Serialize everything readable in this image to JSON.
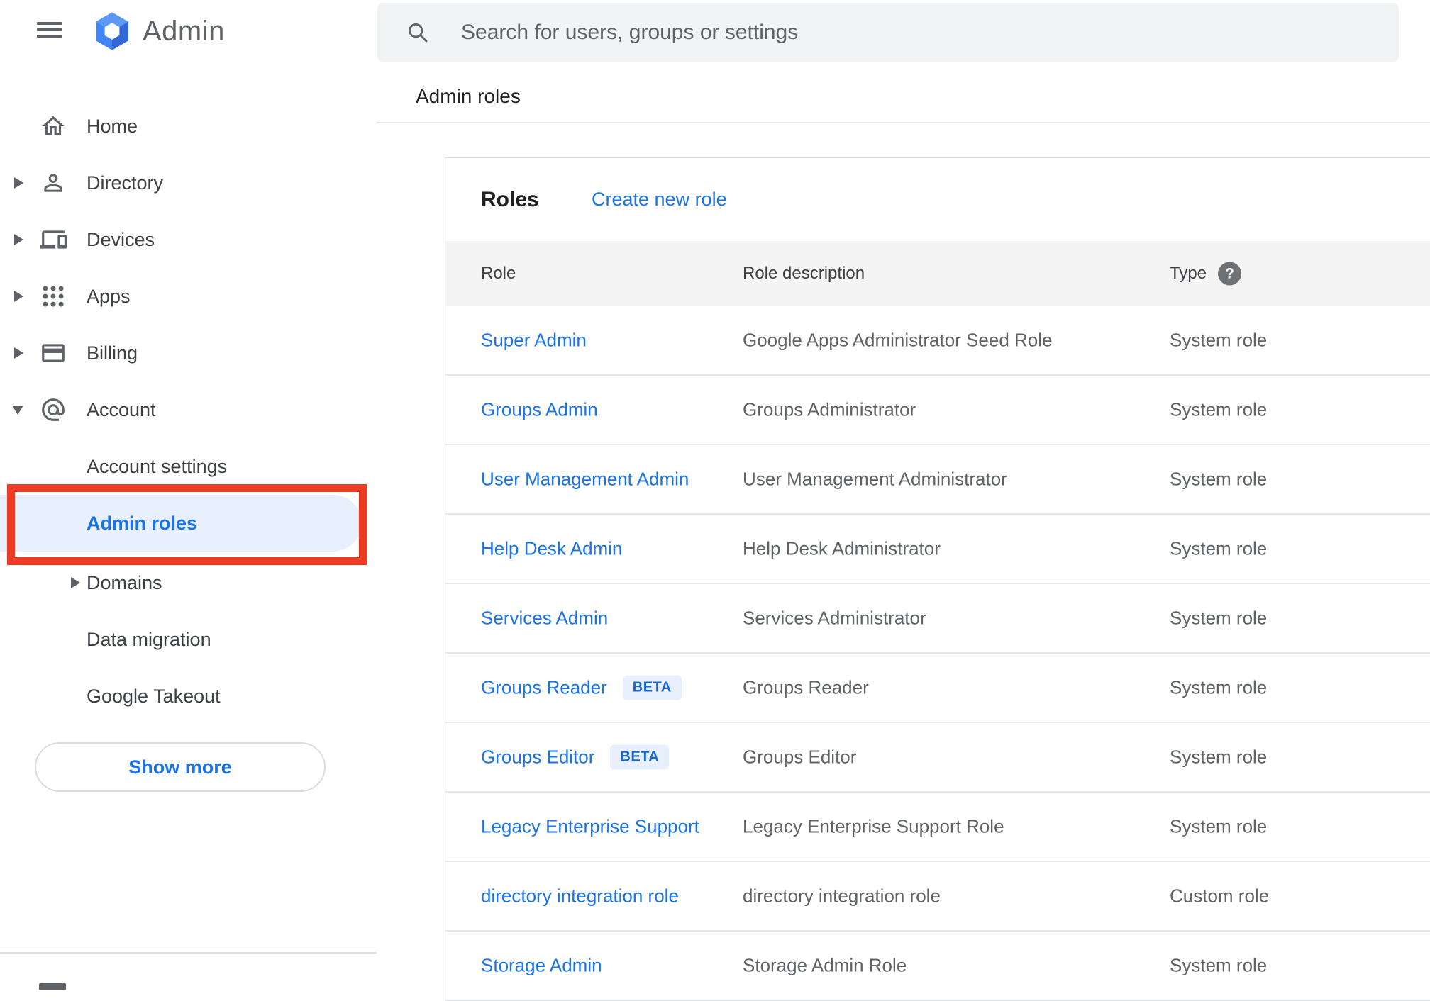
{
  "header": {
    "app_name": "Admin",
    "menu_icon": "hamburger-menu-icon",
    "logo_icon": "google-admin-logo"
  },
  "search": {
    "placeholder": "Search for users, groups or settings",
    "icon": "search-icon"
  },
  "page": {
    "title": "Admin roles"
  },
  "sidebar": {
    "items": [
      {
        "label": "Home",
        "icon": "home-icon",
        "expandable": false
      },
      {
        "label": "Directory",
        "icon": "directory-person-icon",
        "expandable": true
      },
      {
        "label": "Devices",
        "icon": "devices-icon",
        "expandable": true
      },
      {
        "label": "Apps",
        "icon": "apps-grid-icon",
        "expandable": true
      },
      {
        "label": "Billing",
        "icon": "billing-card-icon",
        "expandable": true
      },
      {
        "label": "Account",
        "icon": "account-at-icon",
        "expandable": true,
        "expanded": true
      }
    ],
    "account_subitems": [
      {
        "label": "Account settings",
        "selected": false
      },
      {
        "label": "Admin roles",
        "selected": true
      },
      {
        "label": "Domains",
        "selected": false,
        "expandable": true
      },
      {
        "label": "Data migration",
        "selected": false
      },
      {
        "label": "Google Takeout",
        "selected": false
      }
    ],
    "show_more_label": "Show more"
  },
  "main": {
    "card_title": "Roles",
    "create_link_label": "Create new role",
    "table": {
      "columns": {
        "role": "Role",
        "description": "Role description",
        "type": "Type"
      },
      "type_help_icon": "help-question-icon",
      "help_glyph": "?",
      "rows": [
        {
          "role": "Super Admin",
          "description": "Google Apps Administrator Seed Role",
          "type": "System role"
        },
        {
          "role": "Groups Admin",
          "description": "Groups Administrator",
          "type": "System role"
        },
        {
          "role": "User Management Admin",
          "description": "User Management Administrator",
          "type": "System role"
        },
        {
          "role": "Help Desk Admin",
          "description": "Help Desk Administrator",
          "type": "System role"
        },
        {
          "role": "Services Admin",
          "description": "Services Administrator",
          "type": "System role"
        },
        {
          "role": "Groups Reader",
          "beta": "BETA",
          "description": "Groups Reader",
          "type": "System role"
        },
        {
          "role": "Groups Editor",
          "beta": "BETA",
          "description": "Groups Editor",
          "type": "System role"
        },
        {
          "role": "Legacy Enterprise Support",
          "description": "Legacy Enterprise Support Role",
          "type": "System role"
        },
        {
          "role": "directory integration role",
          "description": "directory integration role",
          "type": "Custom role"
        },
        {
          "role": "Storage Admin",
          "description": "Storage Admin Role",
          "type": "System role"
        }
      ]
    }
  },
  "annotation": {
    "type": "red-highlight-box",
    "target": "Admin roles sidebar item"
  },
  "colors": {
    "accent_blue": "#1a73e8",
    "selected_item_bg": "#e8f0fe",
    "badge_bg": "#e8f0fe",
    "badge_text": "#1967d2",
    "annotation_red": "#ee3b24",
    "search_bar_bg": "#f1f3f4",
    "table_head_bg": "#f4f4f5",
    "logo_blue": "#4285f4",
    "text_gray": "#5f6368"
  }
}
